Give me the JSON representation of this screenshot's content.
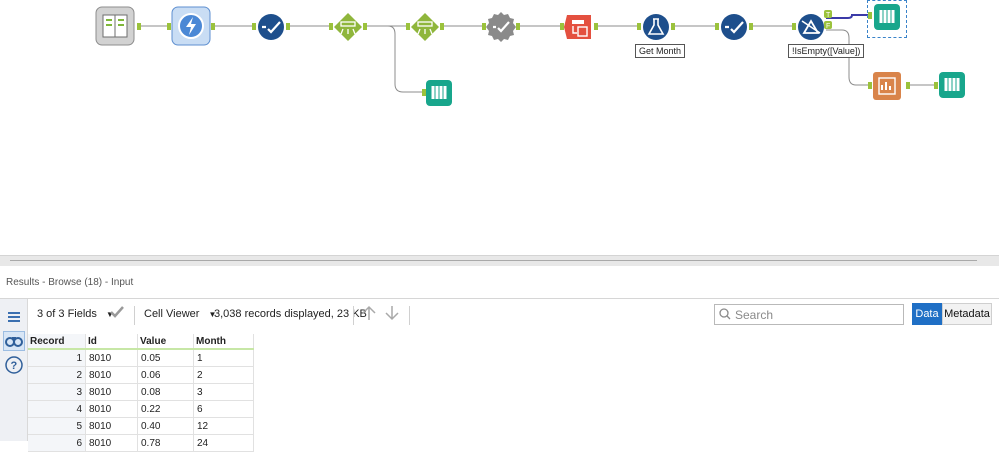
{
  "canvas": {
    "annotations": {
      "formula": "Get Month",
      "filter": "!IsEmpty([Value])"
    },
    "tools": [
      "input-data-icon",
      "dynamic-input-icon",
      "select-icon",
      "text-to-columns-icon",
      "text-to-columns-icon",
      "auto-field-icon",
      "transpose-icon",
      "formula-icon",
      "select-icon",
      "filter-icon",
      "browse-icon",
      "browse-icon",
      "report-icon",
      "browse-icon"
    ]
  },
  "results": {
    "title": "Results - Browse (18) - Input",
    "fields_label": "3 of 3 Fields",
    "viewer_label": "Cell Viewer",
    "records_info": "3,038 records displayed, 23 KB",
    "search_placeholder": "Search",
    "data_button": "Data",
    "metadata_button": "Metadata",
    "columns": [
      "Record",
      "Id",
      "Value",
      "Month"
    ],
    "rows": [
      [
        "1",
        "8010",
        "0.05",
        "1"
      ],
      [
        "2",
        "8010",
        "0.06",
        "2"
      ],
      [
        "3",
        "8010",
        "0.08",
        "3"
      ],
      [
        "4",
        "8010",
        "0.22",
        "6"
      ],
      [
        "5",
        "8010",
        "0.40",
        "12"
      ],
      [
        "6",
        "8010",
        "0.78",
        "24"
      ]
    ]
  },
  "colors": {
    "select": "#1e4f8c",
    "text_to_columns": "#8fb63c",
    "auto_field": "#8a8a8a",
    "transpose": "#e4503f",
    "formula": "#1e4f8c",
    "browse": "#18a68c",
    "report": "#d9844a",
    "connector": "#9bc23c",
    "accent": "#1f6fc5"
  }
}
